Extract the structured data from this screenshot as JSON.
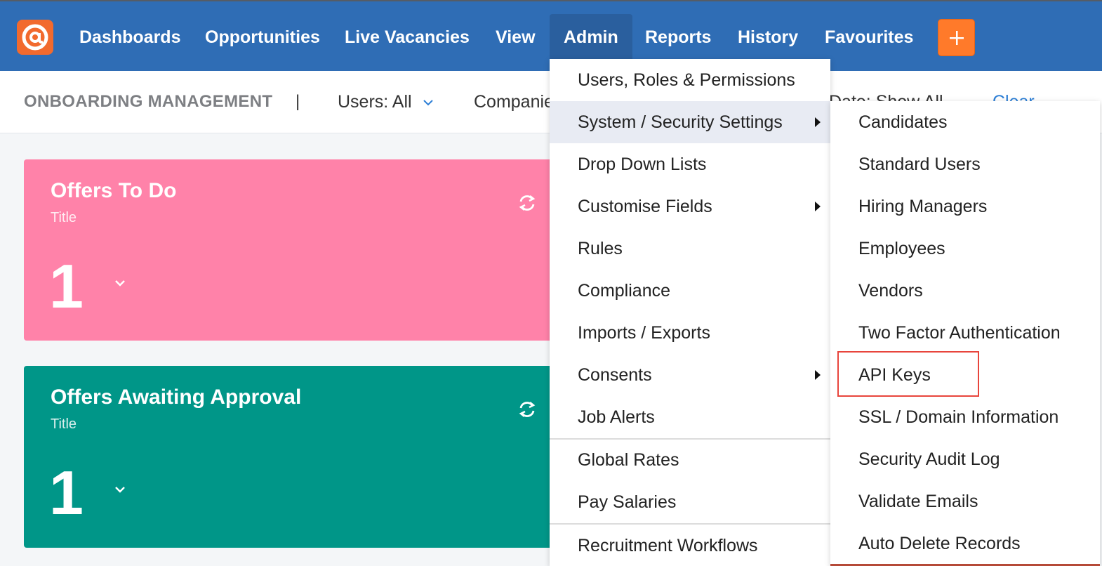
{
  "nav": {
    "items": [
      "Dashboards",
      "Opportunities",
      "Live Vacancies",
      "View",
      "Admin",
      "Reports",
      "History",
      "Favourites"
    ],
    "active": "Admin",
    "plus_label": "+"
  },
  "filterbar": {
    "title": "ONBOARDING MANAGEMENT",
    "separator": "|",
    "users_filter": "Users: All",
    "companies_filter": "Companies",
    "date_filter": "Date: Show All",
    "clear_label": "Clear"
  },
  "cards": [
    {
      "title": "Offers To Do",
      "subtitle": "Title",
      "value": "1",
      "color": "#ff82a9"
    },
    {
      "title": "Offers Awaiting Approval",
      "subtitle": "Title",
      "value": "1",
      "color": "#009688"
    }
  ],
  "admin_menu": {
    "items": [
      {
        "label": "Users, Roles & Permissions"
      },
      {
        "label": "System / Security Settings",
        "submenu": true,
        "highlighted": true
      },
      {
        "label": "Drop Down Lists"
      },
      {
        "label": "Customise Fields",
        "submenu": true
      },
      {
        "label": "Rules"
      },
      {
        "label": "Compliance"
      },
      {
        "label": "Imports / Exports"
      },
      {
        "label": "Consents",
        "submenu": true
      },
      {
        "label": "Job Alerts"
      },
      {
        "label": "Global Rates"
      },
      {
        "label": "Pay Salaries"
      },
      {
        "label": "Recruitment Workflows"
      }
    ]
  },
  "security_submenu": {
    "items": [
      "Candidates",
      "Standard Users",
      "Hiring Managers",
      "Employees",
      "Vendors",
      "Two Factor Authentication",
      "API Keys",
      "SSL / Domain Information",
      "Security Audit Log",
      "Validate Emails",
      "Auto Delete Records"
    ],
    "highlighted_item": "API Keys"
  },
  "colors": {
    "nav_bg": "#2f6db5",
    "brand_orange": "#f26a2e",
    "highlight_box": "#e8453c"
  }
}
